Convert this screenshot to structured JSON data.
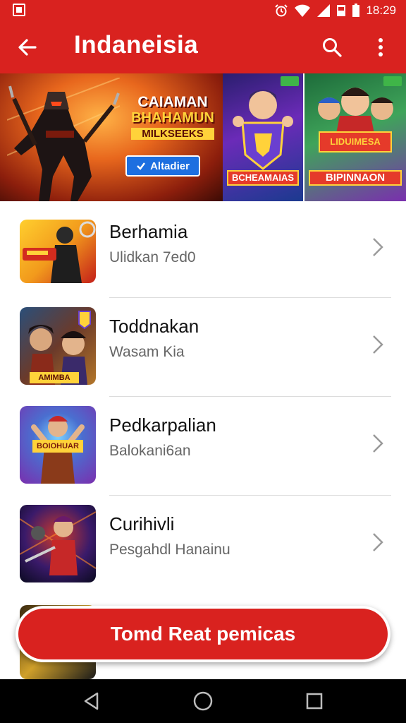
{
  "status_bar": {
    "time": "18:29",
    "icons": [
      "notification-icon",
      "alarm-icon",
      "wifi-icon",
      "signal-icon",
      "battery-icon"
    ]
  },
  "app_bar": {
    "title": "Indaneisia",
    "back_icon": "arrow-back-icon",
    "search_icon": "search-icon",
    "more_icon": "more-vert-icon"
  },
  "banner": {
    "tag": "",
    "headline_1": "CAIAMAN",
    "headline_2": "BHAHAMUN",
    "headline_3": "MILKSEEKS",
    "cta_label": "Altadier",
    "cards": [
      {
        "label": "BCHEAMAIAS"
      },
      {
        "flag": "LIDUIMESA",
        "label": "BIPINNAON"
      }
    ]
  },
  "games": [
    {
      "title": "Berhamia",
      "subtitle": "Ulidkan 7ed0"
    },
    {
      "title": "Toddnakan",
      "subtitle": "Wasam Kia",
      "thumb_label": "AMIMBA"
    },
    {
      "title": "Pedkarpalian",
      "subtitle": "Balokani6an",
      "thumb_label": "BOIOHUAR"
    },
    {
      "title": "Curihivli",
      "subtitle": "Pesgahdl Hanainu"
    }
  ],
  "fab": {
    "label": "Tomd Reat pemicas"
  },
  "nav_bar": {
    "icons": [
      "back-triangle-icon",
      "home-circle-icon",
      "recents-square-icon"
    ]
  },
  "colors": {
    "primary": "#d9221f",
    "text": "#111111",
    "subtext": "#666666",
    "divider": "#dcdcdc"
  }
}
